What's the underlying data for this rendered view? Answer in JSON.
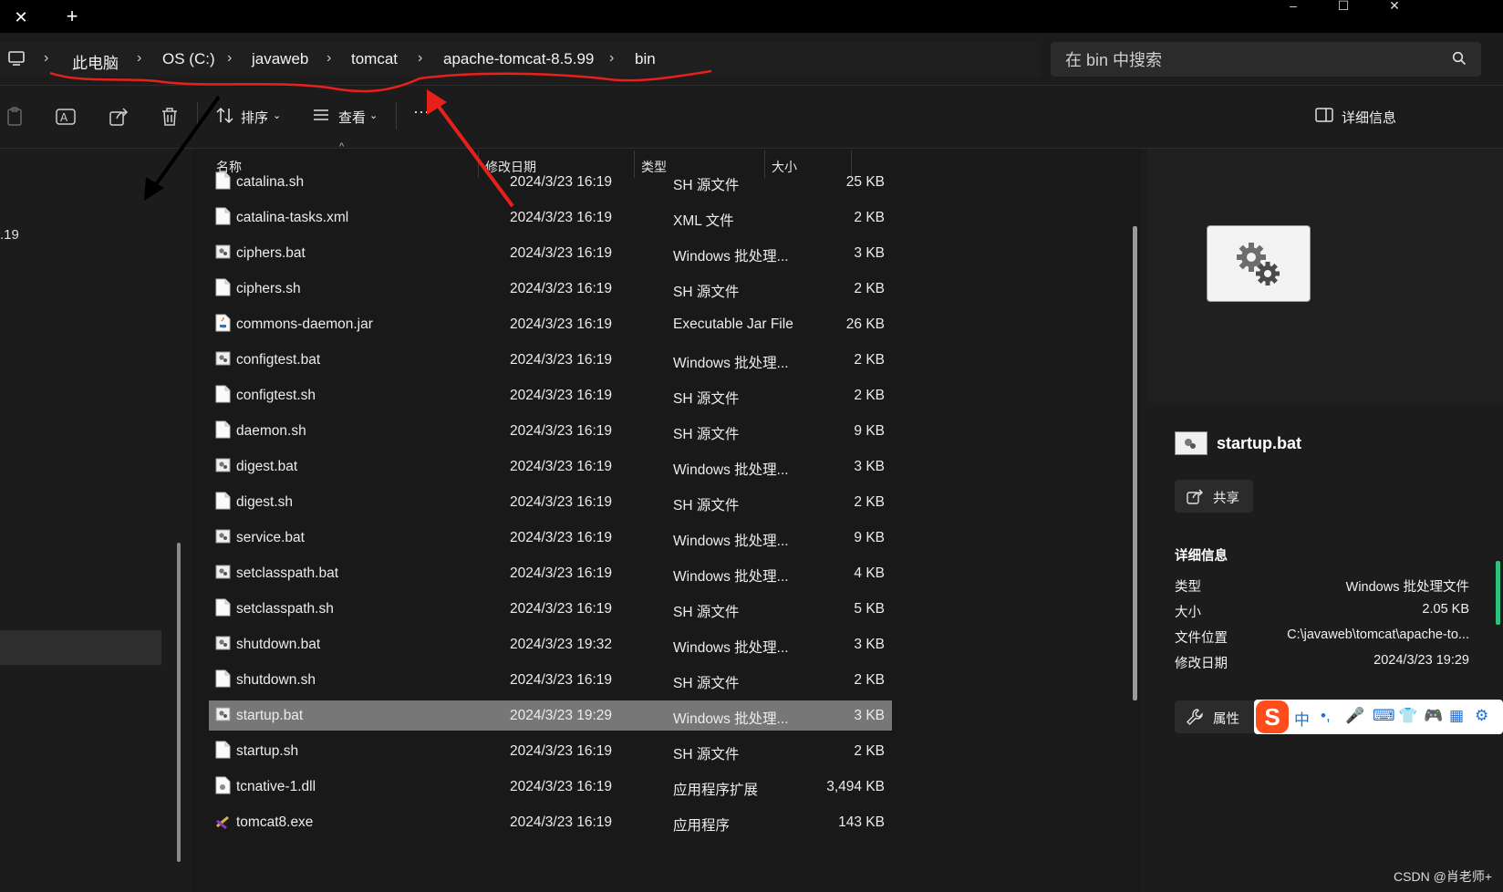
{
  "window": {
    "tab_close": "✕",
    "tab_add": "+",
    "minimize": "–",
    "maximize": "☐",
    "close": "✕"
  },
  "breadcrumb": [
    "此电脑",
    "OS (C:)",
    "javaweb",
    "tomcat",
    "apache-tomcat-8.5.99",
    "bin"
  ],
  "search": {
    "placeholder": "在 bin 中搜索"
  },
  "toolbar": {
    "sort_label": "排序",
    "view_label": "查看",
    "more_label": "···",
    "details_label": "详细信息"
  },
  "nav": {
    "partial_label": ".19"
  },
  "columns": {
    "name": "名称",
    "date": "修改日期",
    "type": "类型",
    "size": "大小"
  },
  "files": [
    {
      "name": "catalina.sh",
      "date": "2024/3/23 16:19",
      "type": "SH 源文件",
      "size": "25 KB",
      "icon": "text-file-icon"
    },
    {
      "name": "catalina-tasks.xml",
      "date": "2024/3/23 16:19",
      "type": "XML 文件",
      "size": "2 KB",
      "icon": "text-file-icon"
    },
    {
      "name": "ciphers.bat",
      "date": "2024/3/23 16:19",
      "type": "Windows 批处理...",
      "size": "3 KB",
      "icon": "batch-file-icon"
    },
    {
      "name": "ciphers.sh",
      "date": "2024/3/23 16:19",
      "type": "SH 源文件",
      "size": "2 KB",
      "icon": "text-file-icon"
    },
    {
      "name": "commons-daemon.jar",
      "date": "2024/3/23 16:19",
      "type": "Executable Jar File",
      "size": "26 KB",
      "icon": "jar-file-icon"
    },
    {
      "name": "configtest.bat",
      "date": "2024/3/23 16:19",
      "type": "Windows 批处理...",
      "size": "2 KB",
      "icon": "batch-file-icon"
    },
    {
      "name": "configtest.sh",
      "date": "2024/3/23 16:19",
      "type": "SH 源文件",
      "size": "2 KB",
      "icon": "text-file-icon"
    },
    {
      "name": "daemon.sh",
      "date": "2024/3/23 16:19",
      "type": "SH 源文件",
      "size": "9 KB",
      "icon": "text-file-icon"
    },
    {
      "name": "digest.bat",
      "date": "2024/3/23 16:19",
      "type": "Windows 批处理...",
      "size": "3 KB",
      "icon": "batch-file-icon"
    },
    {
      "name": "digest.sh",
      "date": "2024/3/23 16:19",
      "type": "SH 源文件",
      "size": "2 KB",
      "icon": "text-file-icon"
    },
    {
      "name": "service.bat",
      "date": "2024/3/23 16:19",
      "type": "Windows 批处理...",
      "size": "9 KB",
      "icon": "batch-file-icon"
    },
    {
      "name": "setclasspath.bat",
      "date": "2024/3/23 16:19",
      "type": "Windows 批处理...",
      "size": "4 KB",
      "icon": "batch-file-icon"
    },
    {
      "name": "setclasspath.sh",
      "date": "2024/3/23 16:19",
      "type": "SH 源文件",
      "size": "5 KB",
      "icon": "text-file-icon"
    },
    {
      "name": "shutdown.bat",
      "date": "2024/3/23 19:32",
      "type": "Windows 批处理...",
      "size": "3 KB",
      "icon": "batch-file-icon"
    },
    {
      "name": "shutdown.sh",
      "date": "2024/3/23 16:19",
      "type": "SH 源文件",
      "size": "2 KB",
      "icon": "text-file-icon"
    },
    {
      "name": "startup.bat",
      "date": "2024/3/23 19:29",
      "type": "Windows 批处理...",
      "size": "3 KB",
      "icon": "batch-file-icon",
      "selected": true
    },
    {
      "name": "startup.sh",
      "date": "2024/3/23 16:19",
      "type": "SH 源文件",
      "size": "2 KB",
      "icon": "text-file-icon"
    },
    {
      "name": "tcnative-1.dll",
      "date": "2024/3/23 16:19",
      "type": "应用程序扩展",
      "size": "3,494 KB",
      "icon": "dll-file-icon"
    },
    {
      "name": "tomcat8.exe",
      "date": "2024/3/23 16:19",
      "type": "应用程序",
      "size": "143 KB",
      "icon": "exe-file-icon"
    }
  ],
  "details": {
    "filename": "startup.bat",
    "share_label": "共享",
    "section_title": "详细信息",
    "rows": [
      {
        "key": "类型",
        "value": "Windows 批处理文件"
      },
      {
        "key": "大小",
        "value": "2.05 KB"
      },
      {
        "key": "文件位置",
        "value": "C:\\javaweb\\tomcat\\apache-to..."
      },
      {
        "key": "修改日期",
        "value": "2024/3/23 19:29"
      }
    ],
    "properties_label": "属性"
  },
  "ime": {
    "logo": "S",
    "items": [
      "中",
      "•,",
      "🎤",
      "⌨",
      "👕",
      "🎮",
      "▦",
      "⚙"
    ]
  },
  "watermark": "CSDN @肖老师+",
  "colors": {
    "annotation_red": "#e8201c",
    "annotation_black": "#000000",
    "selection": "#777777"
  }
}
